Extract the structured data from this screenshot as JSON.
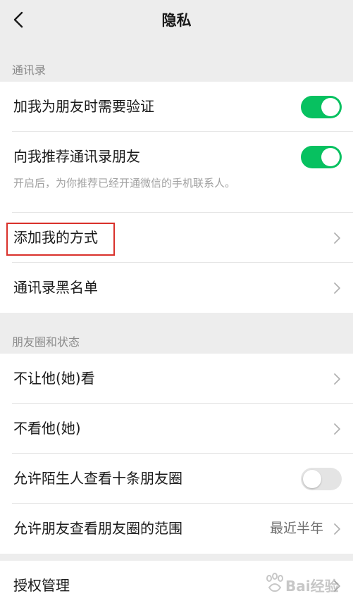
{
  "header": {
    "title": "隐私",
    "back_icon": "chevron-left-icon"
  },
  "sections": {
    "contacts": {
      "label": "通讯录",
      "add_verify": {
        "label": "加我为朋友时需要验证",
        "toggle": true
      },
      "recommend": {
        "label": "向我推荐通讯录朋友",
        "toggle": true,
        "hint": "开启后，为你推荐已经开通微信的手机联系人。"
      },
      "add_methods": {
        "label": "添加我的方式"
      },
      "blacklist": {
        "label": "通讯录黑名单"
      }
    },
    "moments": {
      "label": "朋友圈和状态",
      "hide_from": {
        "label": "不让他(她)看"
      },
      "dont_see": {
        "label": "不看他(她)"
      },
      "strangers": {
        "label": "允许陌生人查看十条朋友圈",
        "toggle": false
      },
      "range": {
        "label": "允许朋友查看朋友圈的范围",
        "value": "最近半年"
      }
    },
    "auth": {
      "label": "授权管理"
    }
  },
  "colors": {
    "accent": "#07c160",
    "highlight": "#d9312b",
    "background": "#ededed"
  },
  "watermark": {
    "text": "Bai经验"
  }
}
